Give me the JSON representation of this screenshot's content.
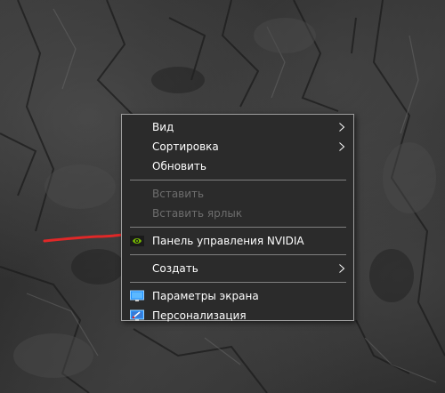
{
  "context_menu": {
    "items": [
      {
        "label": "Вид",
        "has_submenu": true,
        "enabled": true
      },
      {
        "label": "Сортировка",
        "has_submenu": true,
        "enabled": true
      },
      {
        "label": "Обновить",
        "has_submenu": false,
        "enabled": true
      },
      {
        "label": "Вставить",
        "has_submenu": false,
        "enabled": false
      },
      {
        "label": "Вставить ярлык",
        "has_submenu": false,
        "enabled": false
      },
      {
        "label": "Панель управления NVIDIA",
        "has_submenu": false,
        "enabled": true,
        "icon": "nvidia-icon"
      },
      {
        "label": "Создать",
        "has_submenu": true,
        "enabled": true
      },
      {
        "label": "Параметры экрана",
        "has_submenu": false,
        "enabled": true,
        "icon": "display-settings-icon"
      },
      {
        "label": "Персонализация",
        "has_submenu": false,
        "enabled": true,
        "icon": "personalization-icon"
      }
    ]
  },
  "colors": {
    "menu_background": "#2b2b2b",
    "menu_border": "#a0a0a0",
    "enabled_text": "#ffffff",
    "disabled_text": "#6d6d6d",
    "separator": "#808080",
    "annotation_mark": "#e02828",
    "nvidia_green": "#76b900"
  }
}
